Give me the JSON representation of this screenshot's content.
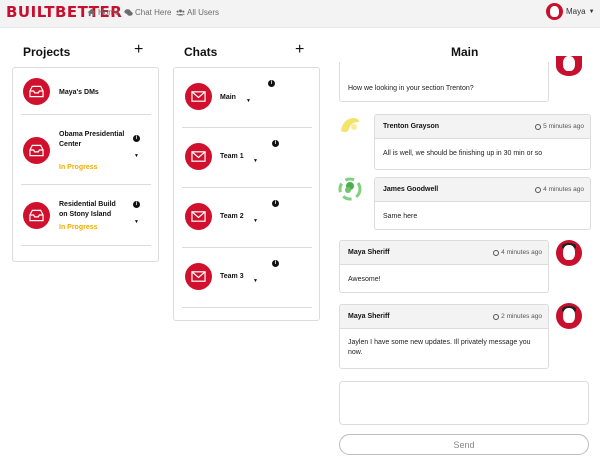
{
  "navbar": {
    "brand": "BUILTBETTER",
    "links": [
      {
        "label": "Home",
        "icon": "home-icon"
      },
      {
        "label": "Chat Here",
        "icon": "chat-bubbles-icon"
      },
      {
        "label": "All Users",
        "icon": "users-icon"
      }
    ],
    "user": {
      "name": "Maya"
    }
  },
  "projects": {
    "title": "Projects",
    "add_label": "+",
    "items": [
      {
        "name": "Maya's DMs",
        "status": ""
      },
      {
        "name": "Obama Presidential Center",
        "status": "In Progress"
      },
      {
        "name": "Residential Build on Stony Island",
        "status": "In Progress"
      }
    ]
  },
  "chats": {
    "title": "Chats",
    "add_label": "+",
    "items": [
      {
        "name": "Main"
      },
      {
        "name": "Team 1"
      },
      {
        "name": "Team 2"
      },
      {
        "name": "Team 3"
      }
    ]
  },
  "main": {
    "title": "Main",
    "messages": [
      {
        "author": "",
        "time": "",
        "text": "How we looking in your section Trenton?"
      },
      {
        "author": "Trenton Grayson",
        "time": "5 minutes ago",
        "text": "All is well, we should be finishing up in 30 min or so"
      },
      {
        "author": "James Goodwell",
        "time": "4 minutes ago",
        "text": "Same here"
      },
      {
        "author": "Maya Sheriff",
        "time": "4 minutes ago",
        "text": "Awesome!"
      },
      {
        "author": "Maya Sheriff",
        "time": "2 minutes ago",
        "text": "Jaylen I have some new updates. Ill privately message you now."
      }
    ],
    "compose_placeholder": "",
    "send_label": "Send"
  },
  "colors": {
    "brand": "#c8102e",
    "status_in_progress": "#f0ad00"
  }
}
